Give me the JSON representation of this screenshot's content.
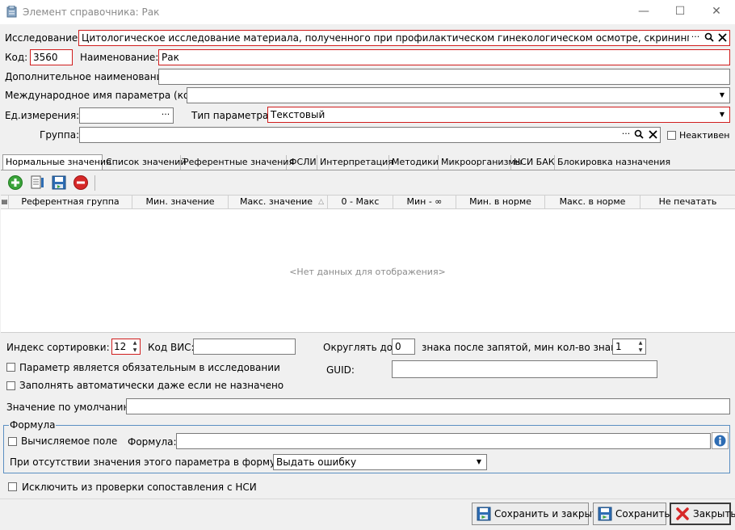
{
  "window": {
    "title": "Элемент справочника: Рак",
    "minimize": "—",
    "maximize": "☐",
    "close": "✕"
  },
  "form": {
    "study_label": "Исследование:",
    "study_value": "Цитологическое исследование материала, полученного при профилактическом гинекологическом осмотре, скрининге",
    "code_label": "Код:",
    "code_value": "3560",
    "name_label": "Наименование:",
    "name_value": "Рак",
    "extra_name_label": "Дополнительное наименование:",
    "extra_name_value": "",
    "intl_name_label": "Международное имя параметра (код):",
    "intl_name_value": "",
    "unit_label": "Ед.измерения:",
    "unit_value": "",
    "param_type_label": "Тип параметра:",
    "param_type_value": "Текстовый",
    "group_label": "Группа:",
    "group_value": "",
    "inactive_label": "Неактивен",
    "dots": "···"
  },
  "tabs": [
    {
      "label": "Нормальные значения",
      "active": true
    },
    {
      "label": "Список значений"
    },
    {
      "label": "Референтные значения"
    },
    {
      "label": "ФСЛИ"
    },
    {
      "label": "Интерпретация"
    },
    {
      "label": "Методики"
    },
    {
      "label": "Микроорганизмы"
    },
    {
      "label": "НСИ БАК"
    },
    {
      "label": "Блокировка назначения"
    }
  ],
  "grid": {
    "columns": [
      "Референтная группа",
      "Мин. значение",
      "Макс. значение",
      "0 - Макс",
      "Мин - ∞",
      "Мин. в норме",
      "Макс. в норме",
      "Не печатать"
    ],
    "sort_glyph": "△",
    "empty_text": "<Нет данных для отображения>"
  },
  "bottom": {
    "sort_index_label": "Индекс сортировки:",
    "sort_index_value": "12",
    "vis_code_label": "Код ВИС:",
    "vis_code_value": "",
    "round_label": "Округлять до",
    "round_value": "0",
    "decimals_label": "знака после запятой, мин кол-во знаков",
    "decimals_value": "1",
    "mandatory_label": "Параметр является обязательным в исследовании",
    "autofill_label": "Заполнять автоматически даже если не назначено",
    "guid_label": "GUID:",
    "guid_value": "",
    "default_label": "Значение по умолчанию:",
    "default_value": "",
    "formula_group": "Формула",
    "computed_label": "Вычисляемое поле",
    "formula_label": "Формула:",
    "formula_value": "",
    "missing_label": "При отсутствии значения этого параметра в формуле:",
    "missing_value": "Выдать ошибку",
    "exclude_label": "Исключить из проверки сопоставления с НСИ"
  },
  "buttons": {
    "save_close": "Сохранить и закрыть",
    "save": "Сохранить",
    "close": "Закрыть"
  },
  "colors": {
    "required_border": "#d01d1d",
    "accent_blue": "#2e6db4",
    "add_green": "#3aa33a",
    "remove_red": "#d62828"
  }
}
